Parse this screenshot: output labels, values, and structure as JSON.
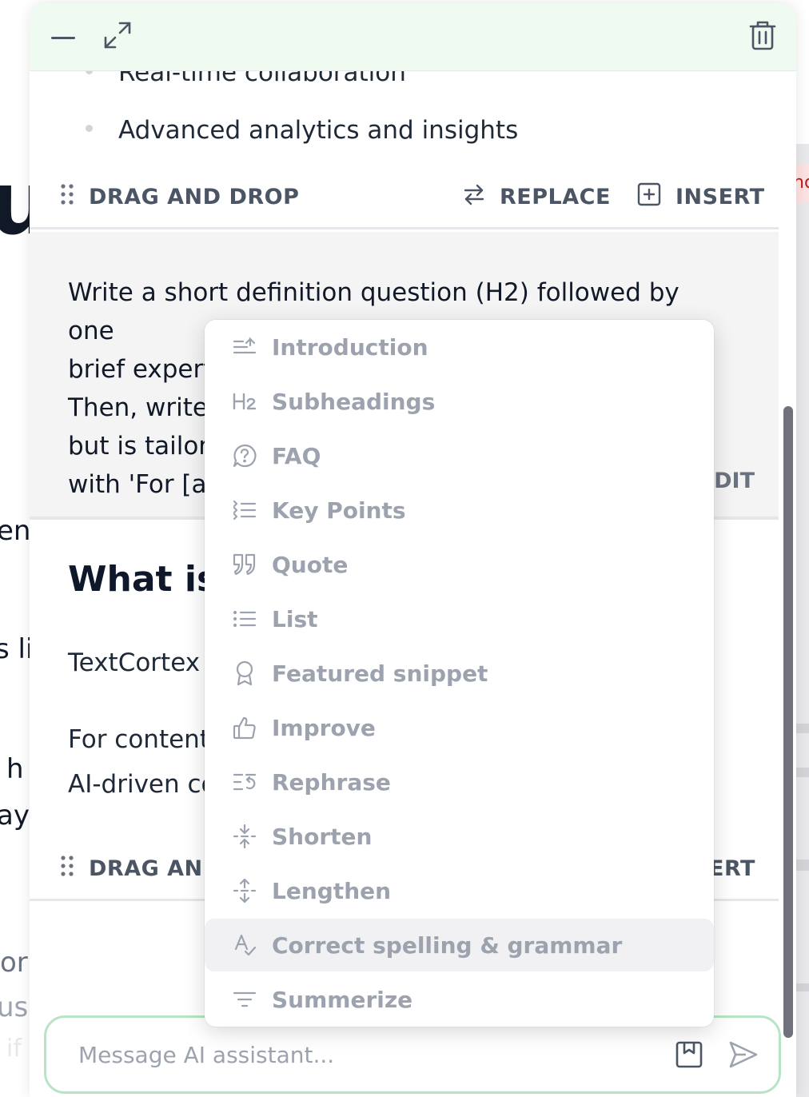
{
  "background_fragments": {
    "big_letter": "u",
    "frag_1": "en",
    "frag_2": "s li",
    "frag_3": "h",
    "frag_4": "ay",
    "frag_5": "or",
    "frag_6": "us",
    "frag_7": "if",
    "frag_8": "nc"
  },
  "header": {
    "minimize_icon": "minus-icon",
    "expand_icon": "expand-icon",
    "delete_icon": "trash-icon"
  },
  "content": {
    "bullets": [
      "Real-time collaboration",
      "Advanced analytics and insights"
    ],
    "action_bar_1": {
      "drag_label": "DRAG AND DROP",
      "replace_label": "REPLACE",
      "insert_label": "INSERT"
    },
    "prompt": {
      "line1": "Write a short definition question (H2) followed by one",
      "line2": "brief expert",
      "line3": "Then, write",
      "line4": "but is tailor",
      "line5": "with 'For [a",
      "edit_label": "EDIT"
    },
    "heading": "What is",
    "para1": "TextCortex",
    "para2_line1": "For content",
    "para2_line2": "AI-driven co",
    "action_bar_2": {
      "drag_label": "DRAG AND",
      "insert_label": "ERT"
    }
  },
  "composer": {
    "placeholder": "Message AI assistant...",
    "save_icon": "bookmark-icon",
    "send_icon": "send-icon"
  },
  "dropdown": {
    "items": [
      {
        "label": "Introduction",
        "icon": "introduction-icon"
      },
      {
        "label": "Subheadings",
        "icon": "h2-icon"
      },
      {
        "label": "FAQ",
        "icon": "faq-icon"
      },
      {
        "label": "Key Points",
        "icon": "key-points-icon"
      },
      {
        "label": "Quote",
        "icon": "quote-icon"
      },
      {
        "label": "List",
        "icon": "list-icon"
      },
      {
        "label": "Featured snippet",
        "icon": "award-icon"
      },
      {
        "label": "Improve",
        "icon": "thumbs-up-icon"
      },
      {
        "label": "Rephrase",
        "icon": "rephrase-icon"
      },
      {
        "label": "Shorten",
        "icon": "shorten-icon"
      },
      {
        "label": "Lengthen",
        "icon": "lengthen-icon"
      },
      {
        "label": "Correct spelling & grammar",
        "icon": "spellcheck-icon",
        "highlighted": true
      },
      {
        "label": "Summerize",
        "icon": "filter-icon"
      }
    ]
  },
  "colors": {
    "header_bg": "#effaf1",
    "composer_border": "#b7e4c4",
    "menu_text": "#9ca3af",
    "highlight_bg": "#f1f1f3"
  }
}
